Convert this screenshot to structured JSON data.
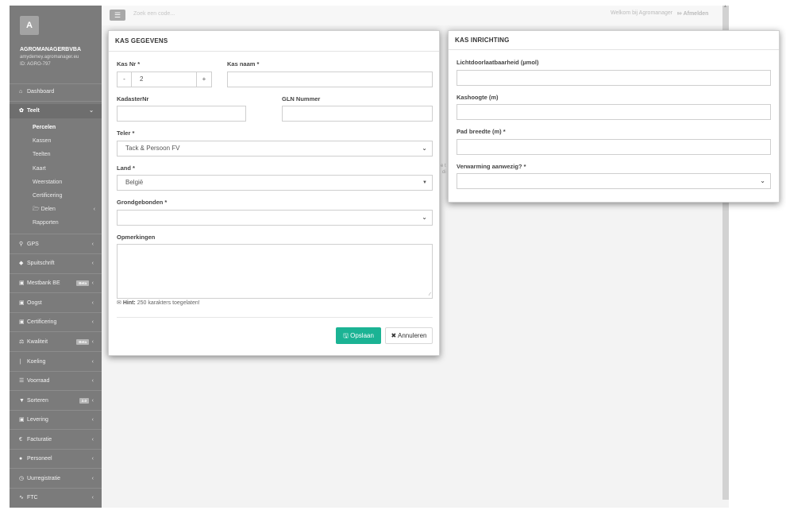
{
  "sidebar": {
    "avatar_letter": "A",
    "org_name": "AGROMANAGERBVBA",
    "org_email": "amydemey.agromanager.eu",
    "org_id": "ID: AGRO-797",
    "dashboard": "Dashboard",
    "teelt": "Teelt",
    "teelt_sub": {
      "percelen": "Percelen",
      "kassen": "Kassen",
      "teelten": "Teelten",
      "kaart": "Kaart",
      "weerstation": "Weerstation",
      "certificering": "Certificering",
      "delen": "Delen",
      "rapporten": "Rapporten"
    },
    "gps": "GPS",
    "spuitschrift": "Spuitschrift",
    "mestbank": "Mestbank BE",
    "mestbank_badge": "Beta",
    "oogst": "Oogst",
    "certificering": "Certificering",
    "kwaliteit": "Kwaliteit",
    "kwaliteit_badge": "Beta",
    "koeling": "Koeling",
    "voorraad": "Voorraad",
    "sorteren": "Sorteren",
    "sorteren_badge": "2.0",
    "levering": "Levering",
    "facturatie": "Facturatie",
    "personeel": "Personeel",
    "uurregistratie": "Uurregistratie",
    "ftc": "FTC"
  },
  "topbar": {
    "search_placeholder": "Zoek een code...",
    "welcome": "Welkom bij Agromanager",
    "logout": "Afmelden"
  },
  "background_text": {
    "line1": "e t",
    "line2": "di"
  },
  "kas_gegevens": {
    "title": "KAS GEGEVENS",
    "kas_nr_label": "Kas Nr *",
    "kas_nr_minus": "-",
    "kas_nr_value": "2",
    "kas_nr_plus": "+",
    "kas_naam_label": "Kas naam *",
    "kas_naam_value": "",
    "kadaster_label": "KadasterNr",
    "kadaster_value": "",
    "gln_label": "GLN Nummer",
    "gln_value": "",
    "teler_label": "Teler *",
    "teler_value": "Tack & Persoon FV",
    "land_label": "Land *",
    "land_value": "België",
    "grond_label": "Grondgebonden *",
    "grond_value": "",
    "opmerkingen_label": "Opmerkingen",
    "opmerkingen_value": "",
    "hint_bold": "Hint:",
    "hint_text": "250 karakters toegelaten!",
    "save_label": "Opslaan",
    "cancel_label": "Annuleren"
  },
  "kas_inrichting": {
    "title": "KAS INRICHTING",
    "licht_label": "Lichtdoorlaatbaarheid (µmol)",
    "licht_value": "",
    "hoogte_label": "Kashoogte (m)",
    "hoogte_value": "",
    "pad_label": "Pad breedte (m) *",
    "pad_value": "",
    "verwarming_label": "Verwarming aanwezig? *",
    "verwarming_value": ""
  }
}
